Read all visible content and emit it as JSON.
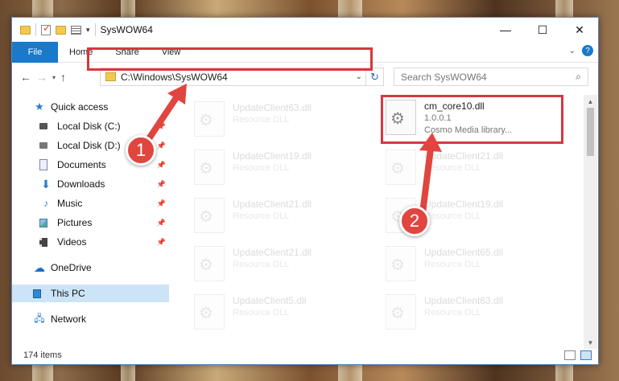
{
  "window": {
    "title": "SysWOW64"
  },
  "ribbon": {
    "tabs": [
      "File",
      "Home",
      "Share",
      "View"
    ]
  },
  "address": {
    "path": "C:\\Windows\\SysWOW64"
  },
  "search": {
    "placeholder": "Search SysWOW64"
  },
  "sidebar": {
    "items": [
      {
        "label": "Quick access",
        "icon": "star-icon"
      },
      {
        "label": "Local Disk (C:)",
        "icon": "disk-icon"
      },
      {
        "label": "Local Disk (D:)",
        "icon": "disk-icon"
      },
      {
        "label": "Documents",
        "icon": "document-icon"
      },
      {
        "label": "Downloads",
        "icon": "download-icon"
      },
      {
        "label": "Music",
        "icon": "music-icon"
      },
      {
        "label": "Pictures",
        "icon": "pictures-icon"
      },
      {
        "label": "Videos",
        "icon": "videos-icon"
      },
      {
        "label": "OneDrive",
        "icon": "cloud-icon"
      },
      {
        "label": "This PC",
        "icon": "pc-icon"
      },
      {
        "label": "Network",
        "icon": "network-icon"
      }
    ]
  },
  "files": {
    "left": [
      {
        "name": "UpdateClient63.dll",
        "desc": "Resource DLL"
      },
      {
        "name": "UpdateClient19.dll",
        "desc": "Resource DLL"
      },
      {
        "name": "UpdateClient21.dll",
        "desc": "Resource DLL"
      },
      {
        "name": "UpdateClient21.dll",
        "desc": "Resource DLL"
      },
      {
        "name": "UpdateClient5.dll",
        "desc": "Resource DLL"
      }
    ],
    "right": [
      {
        "name": "cm_core10.dll",
        "version": "1.0.0.1",
        "desc": "Cosmo Media library..."
      },
      {
        "name": "UpdateClient21.dll",
        "desc": "Resource DLL"
      },
      {
        "name": "UpdateClient19.dll",
        "desc": "Resource DLL"
      },
      {
        "name": "UpdateClient65.dll",
        "desc": "Resource DLL"
      },
      {
        "name": "UpdateClient63.dll",
        "desc": "Resource DLL"
      }
    ]
  },
  "status": {
    "count": "174 items"
  },
  "annotations": {
    "step1": "1",
    "step2": "2",
    "color": "#e0453f"
  }
}
